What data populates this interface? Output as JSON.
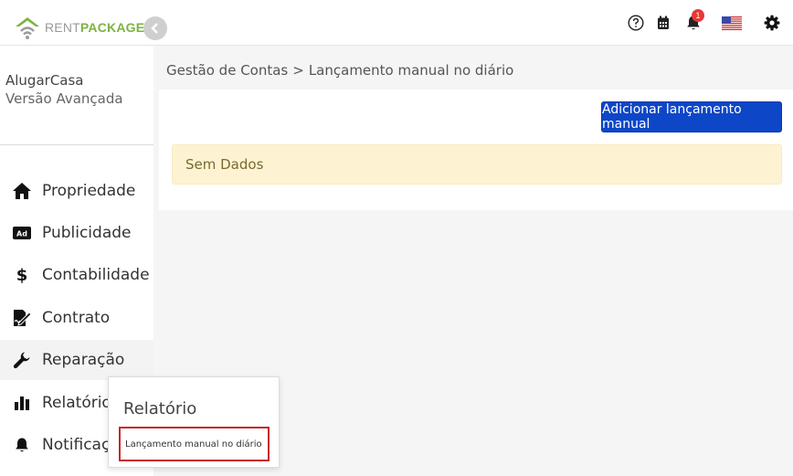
{
  "brand": {
    "rent": "RENT",
    "package": "PACKAGE",
    "accent": "#7cb342"
  },
  "header": {
    "icons": [
      "help-icon",
      "calendar-icon",
      "notification-bell-icon",
      "us-flag-icon",
      "settings-gear-icon"
    ],
    "notification_count": "1"
  },
  "sidebar": {
    "account_name": "AlugarCasa",
    "account_version": "Versão Avançada",
    "items": [
      {
        "label": "Propriedade",
        "icon": "home-icon"
      },
      {
        "label": "Publicidade",
        "icon": "ad-icon"
      },
      {
        "label": "Contabilidade",
        "icon": "dollar-icon"
      },
      {
        "label": "Contrato",
        "icon": "contract-sign-icon"
      },
      {
        "label": "Reparação",
        "icon": "wrench-icon"
      },
      {
        "label": "Relatório",
        "icon": "bar-chart-icon"
      },
      {
        "label": "Notificação",
        "icon": "bell-icon"
      }
    ]
  },
  "breadcrumb": {
    "parent": "Gestão de Contas",
    "separator": ">",
    "current": "Lançamento manual no diário"
  },
  "main": {
    "add_button_label": "Adicionar lançamento manual",
    "empty_message": "Sem Dados",
    "button_color": "#0d47c8",
    "empty_color": "#fdf3d3"
  },
  "flyout": {
    "title": "Relatório",
    "items": [
      {
        "label": "Lançamento manual no diário"
      }
    ]
  }
}
